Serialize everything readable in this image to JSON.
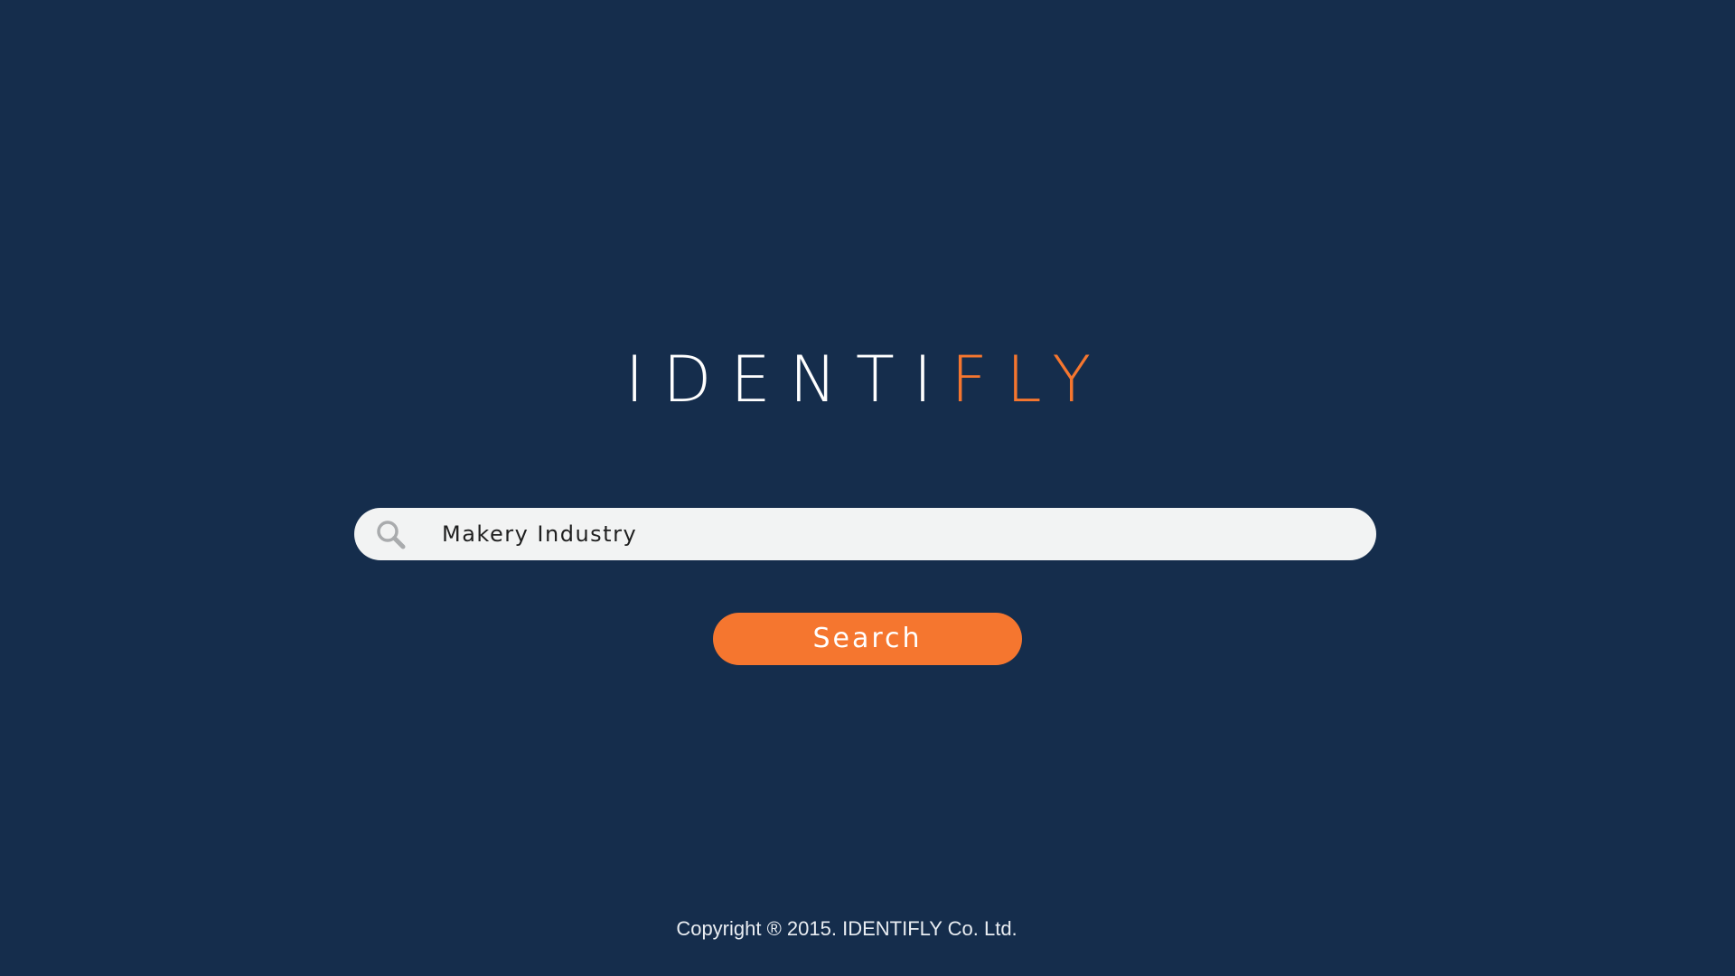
{
  "logo": {
    "part_primary": "IDENTI",
    "part_accent": "FLY"
  },
  "search": {
    "icon": "search-icon",
    "value": "Makery Industry",
    "button_label": "Search"
  },
  "footer": {
    "copyright": "Copyright ® 2015. IDENTIFLY Co. Ltd."
  },
  "colors": {
    "background": "#152d4c",
    "accent": "#f5762f",
    "input_background": "#f2f3f3",
    "text_light": "#ffffff"
  }
}
